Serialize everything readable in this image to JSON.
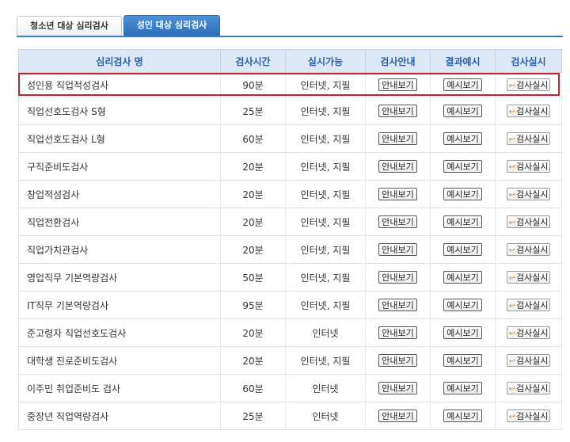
{
  "tabs": [
    {
      "label": "청소년 대상 심리검사",
      "active": false
    },
    {
      "label": "성인 대상 심리검사",
      "active": true
    }
  ],
  "table": {
    "headers": [
      "심리검사 명",
      "검사시간",
      "실시가능",
      "검사안내",
      "결과예시",
      "검사실시"
    ],
    "button_labels": {
      "guide": "안내보기",
      "example": "예시보기",
      "run": "검사실시"
    },
    "rows": [
      {
        "name": "성인용 직업적성검사",
        "time": "90분",
        "mode": "인터넷, 지필"
      },
      {
        "name": "직업선호도검사 S형",
        "time": "25분",
        "mode": "인터넷, 지필"
      },
      {
        "name": "직업선호도검사 L형",
        "time": "60분",
        "mode": "인터넷, 지필"
      },
      {
        "name": "구직준비도검사",
        "time": "20분",
        "mode": "인터넷, 지필"
      },
      {
        "name": "창업적성검사",
        "time": "20분",
        "mode": "인터넷, 지필"
      },
      {
        "name": "직업전환검사",
        "time": "20분",
        "mode": "인터넷, 지필"
      },
      {
        "name": "직업가치관검사",
        "time": "20분",
        "mode": "인터넷, 지필"
      },
      {
        "name": "영업직무 기본역량검사",
        "time": "50분",
        "mode": "인터넷, 지필"
      },
      {
        "name": "IT직무 기본역량검사",
        "time": "95분",
        "mode": "인터넷, 지필"
      },
      {
        "name": "준고령자 직업선호도검사",
        "time": "20분",
        "mode": "인터넷"
      },
      {
        "name": "대학생 진로준비도검사",
        "time": "20분",
        "mode": "인터넷, 지필"
      },
      {
        "name": "이주민 취업준비도 검사",
        "time": "60분",
        "mode": "인터넷"
      },
      {
        "name": "중장년 직업역량검사",
        "time": "25분",
        "mode": "인터넷"
      }
    ]
  },
  "colors": {
    "accent": "#2d6db8",
    "header_bg": "#dce8f5",
    "highlight": "#c0272d",
    "run_arrow": "#d9822b"
  }
}
